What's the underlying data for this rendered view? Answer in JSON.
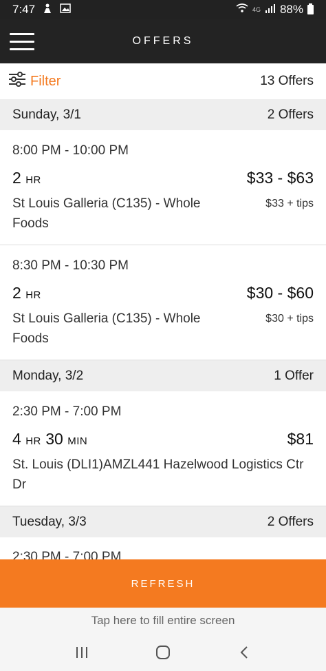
{
  "status_bar": {
    "time": "7:47",
    "network": "4G",
    "battery": "88%"
  },
  "header": {
    "title": "OFFERS"
  },
  "filter": {
    "label": "Filter",
    "total_offers": "13 Offers"
  },
  "days": [
    {
      "label": "Sunday, 3/1",
      "count": "2 Offers",
      "offers": [
        {
          "time": "8:00 PM - 10:00 PM",
          "duration_num": "2",
          "duration_unit": "HR",
          "price": "$33 - $63",
          "location": "St Louis Galleria (C135) - Whole Foods",
          "tips": "$33 + tips"
        },
        {
          "time": "8:30 PM - 10:30 PM",
          "duration_num": "2",
          "duration_unit": "HR",
          "price": "$30 - $60",
          "location": "St Louis Galleria (C135) - Whole Foods",
          "tips": "$30 + tips"
        }
      ]
    },
    {
      "label": "Monday, 3/2",
      "count": "1 Offer",
      "offers": [
        {
          "time": "2:30 PM - 7:00 PM",
          "duration_num": "4",
          "duration_unit": "HR",
          "duration_num2": "30",
          "duration_unit2": "MIN",
          "price": "$81",
          "location": "St. Louis (DLI1)AMZL441 Hazelwood Logistics Ctr Dr"
        }
      ]
    },
    {
      "label": "Tuesday, 3/3",
      "count": "2 Offers",
      "offers": [
        {
          "time": "2:30 PM - 7:00 PM"
        }
      ]
    }
  ],
  "refresh": {
    "label": "REFRESH"
  },
  "fill_hint": {
    "label": "Tap here to fill entire screen"
  },
  "colors": {
    "accent": "#f47a20",
    "header_bg": "#232323",
    "day_header_bg": "#eeeeee"
  }
}
